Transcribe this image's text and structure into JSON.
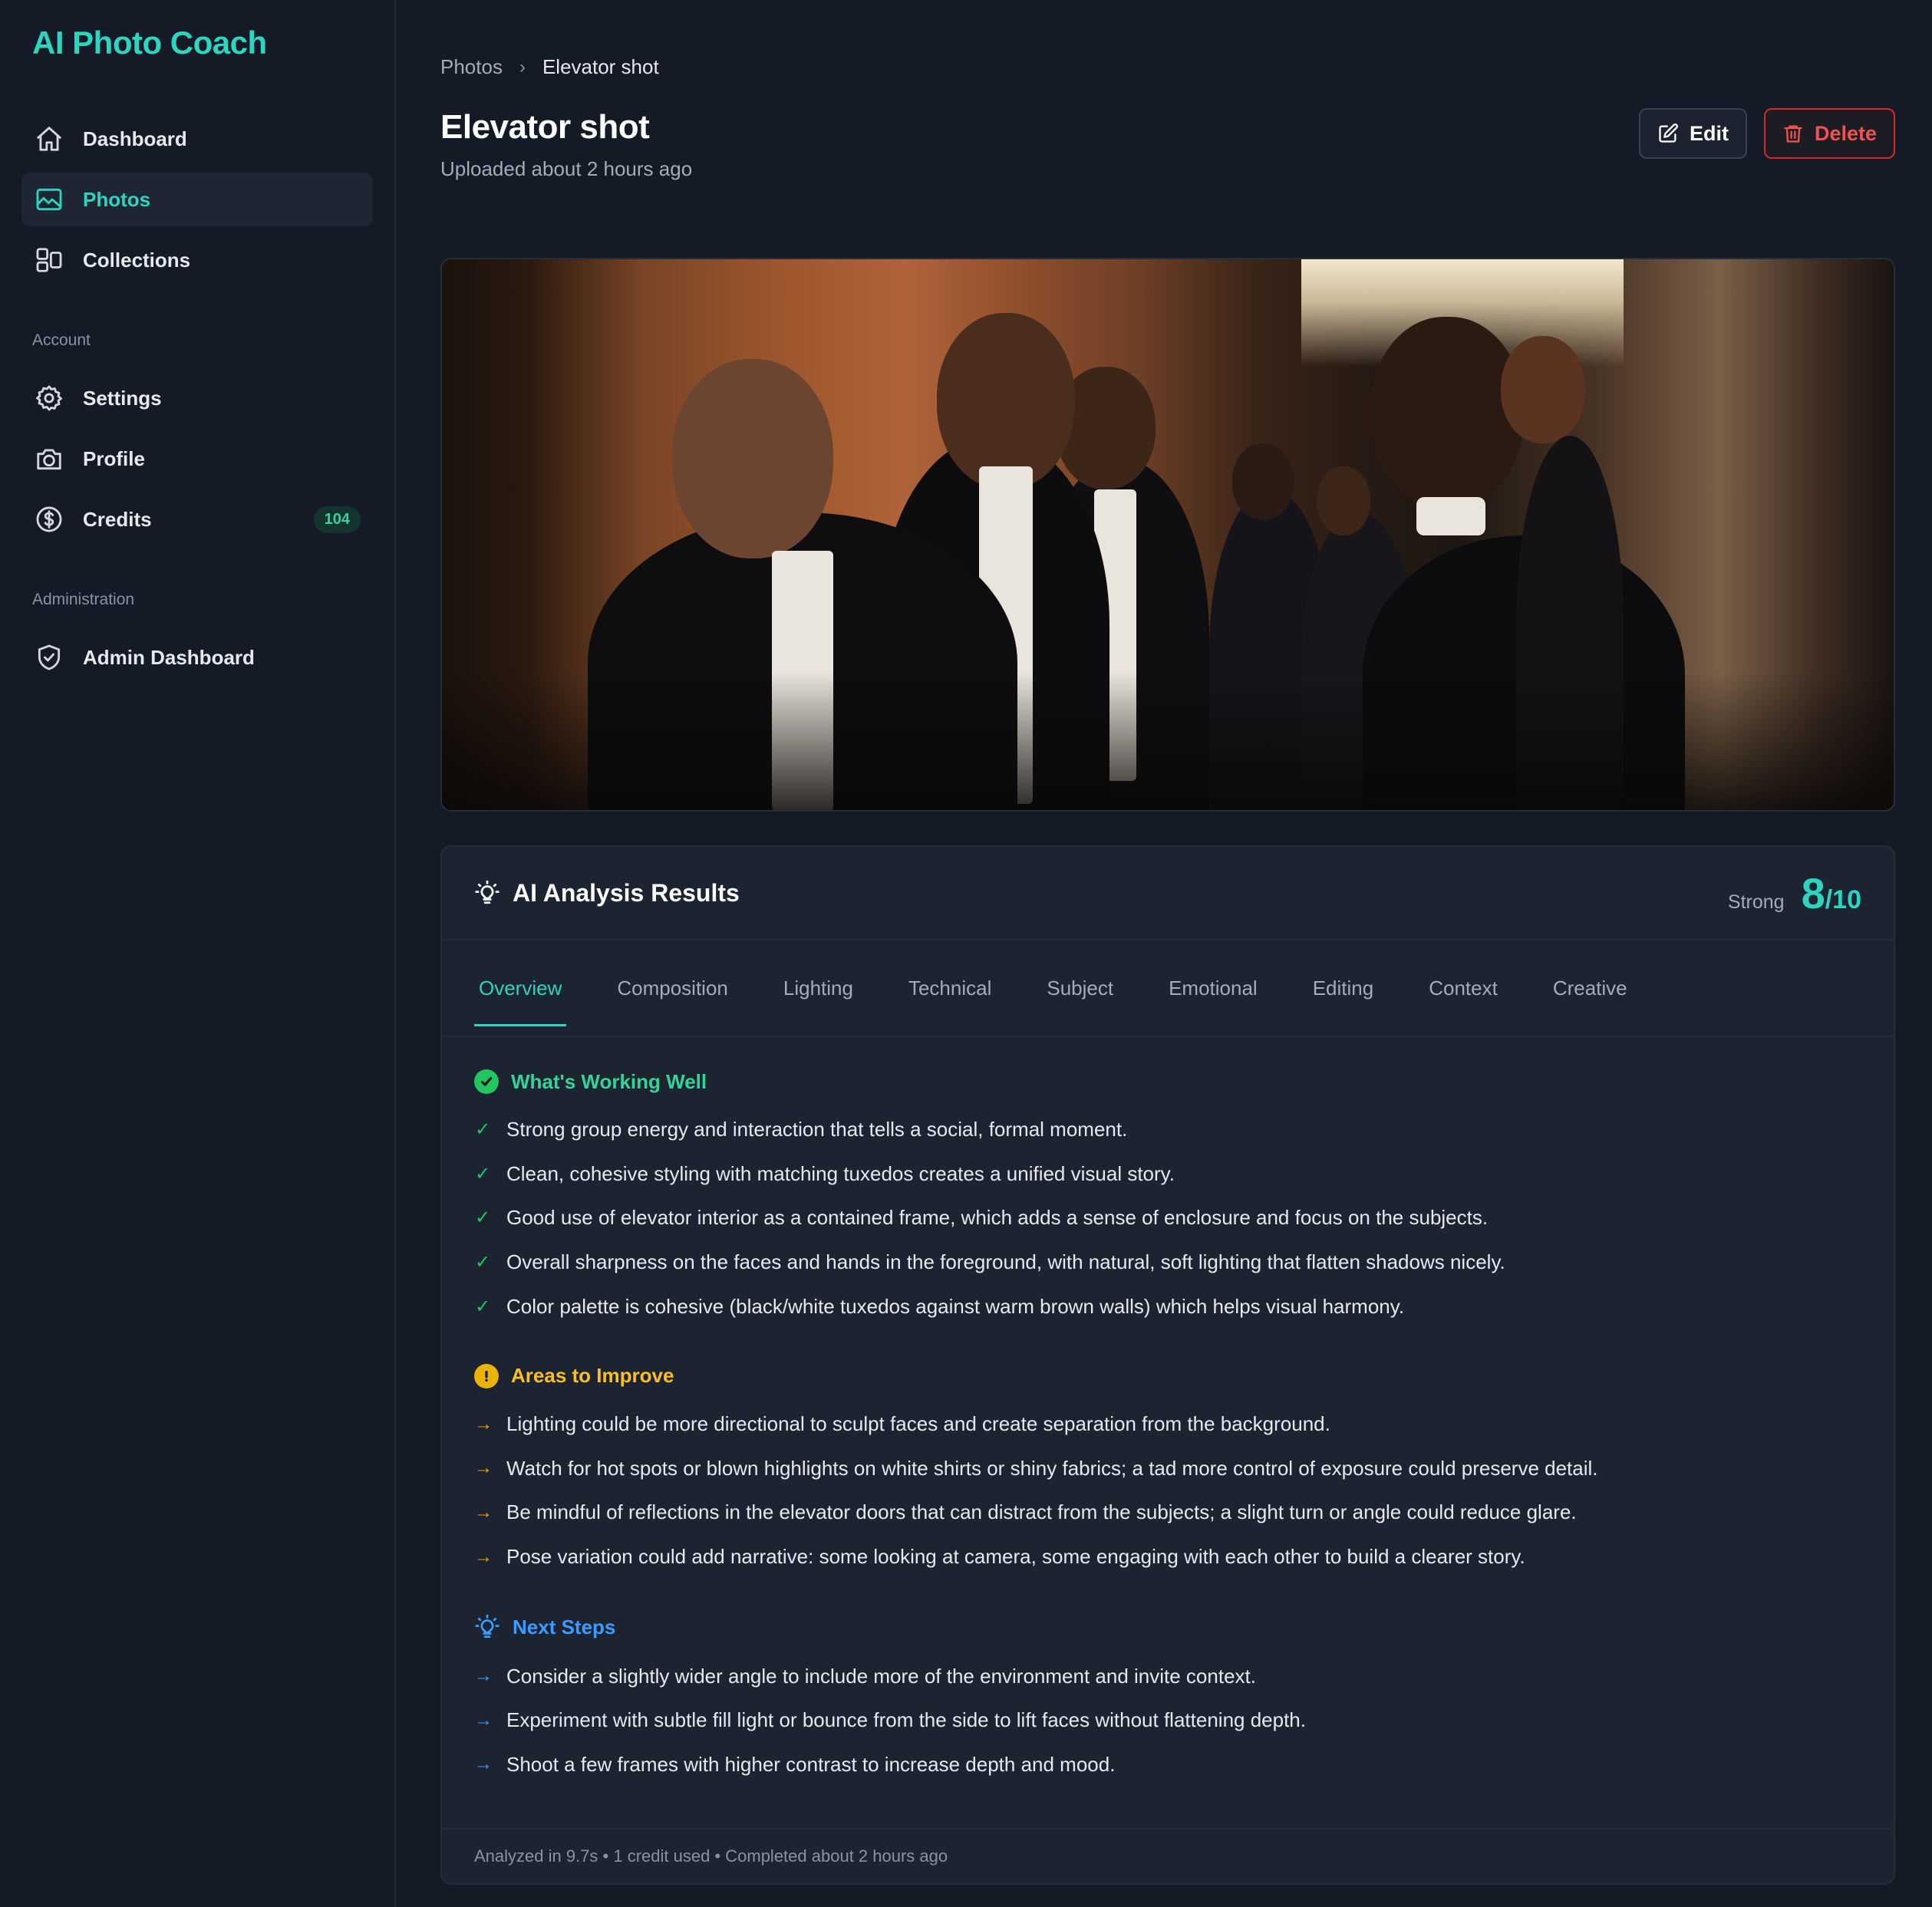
{
  "app": {
    "title": "AI Photo Coach"
  },
  "sidebar": {
    "items": [
      {
        "label": "Dashboard",
        "icon": "home-icon",
        "active": false
      },
      {
        "label": "Photos",
        "icon": "image-icon",
        "active": true
      },
      {
        "label": "Collections",
        "icon": "collections-icon",
        "active": false
      }
    ],
    "account_label": "Account",
    "account_items": [
      {
        "label": "Settings",
        "icon": "gear-icon"
      },
      {
        "label": "Profile",
        "icon": "camera-icon"
      },
      {
        "label": "Credits",
        "icon": "dollar-icon",
        "badge": "104"
      }
    ],
    "admin_label": "Administration",
    "admin_items": [
      {
        "label": "Admin Dashboard",
        "icon": "shield-check-icon"
      }
    ]
  },
  "breadcrumb": {
    "root": "Photos",
    "separator": ">",
    "current": "Elevator shot"
  },
  "page": {
    "title": "Elevator shot",
    "subtitle": "Uploaded about 2 hours ago",
    "edit_label": "Edit",
    "delete_label": "Delete"
  },
  "analysis": {
    "title": "AI Analysis Results",
    "score_label": "Strong",
    "score": "8",
    "score_max": "/10",
    "tabs": [
      "Overview",
      "Composition",
      "Lighting",
      "Technical",
      "Subject",
      "Emotional",
      "Editing",
      "Context",
      "Creative"
    ],
    "active_tab": "Overview",
    "working_well": {
      "title": "What's Working Well",
      "items": [
        "Strong group energy and interaction that tells a social, formal moment.",
        "Clean, cohesive styling with matching tuxedos creates a unified visual story.",
        "Good use of elevator interior as a contained frame, which adds a sense of enclosure and focus on the subjects.",
        "Overall sharpness on the faces and hands in the foreground, with natural, soft lighting that flatten shadows nicely.",
        "Color palette is cohesive (black/white tuxedos against warm brown walls) which helps visual harmony."
      ]
    },
    "improve": {
      "title": "Areas to Improve",
      "items": [
        "Lighting could be more directional to sculpt faces and create separation from the background.",
        "Watch for hot spots or blown highlights on white shirts or shiny fabrics; a tad more control of exposure could preserve detail.",
        "Be mindful of reflections in the elevator doors that can distract from the subjects; a slight turn or angle could reduce glare.",
        "Pose variation could add narrative: some looking at camera, some engaging with each other to build a clearer story."
      ]
    },
    "next_steps": {
      "title": "Next Steps",
      "items": [
        "Consider a slightly wider angle to include more of the environment and invite context.",
        "Experiment with subtle fill light or bounce from the side to lift faces without flattening depth.",
        "Shoot a few frames with higher contrast to increase depth and mood."
      ]
    },
    "footer": "Analyzed in 9.7s • 1 credit used • Completed about 2 hours ago"
  },
  "colors": {
    "accent": "#2dd4bf",
    "good": "#22c55e",
    "warn": "#eab308",
    "next": "#3b9cff",
    "danger": "#dc2626"
  }
}
